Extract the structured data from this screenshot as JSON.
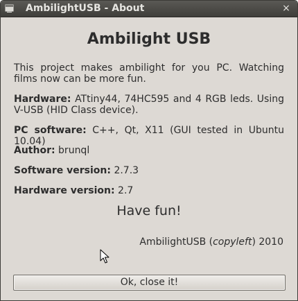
{
  "window": {
    "title": "AmbilightUSB - About",
    "close_glyph": "×"
  },
  "about": {
    "heading": "Ambilight USB",
    "description": "This project makes ambilight for you PC. Watching films now can be more fun.",
    "hardware_label": "Hardware:",
    "hardware_value": "ATtiny44, 74HC595 and 4 RGB leds. Using V-USB (HID Class device).",
    "pc_software_label": "PC software:",
    "pc_software_value": "C++, Qt, X11 (GUI tested in Ubuntu 10.04)",
    "author_label": "Author:",
    "author_value": "brunql",
    "software_version_label": "Software version:",
    "software_version_value": "2.7.3",
    "hardware_version_label": "Hardware version:",
    "hardware_version_value": "2.7",
    "have_fun": "Have fun!",
    "copy_name": "AmbilightUSB (",
    "copy_word": "copyleft",
    "copy_year": ") 2010"
  },
  "buttons": {
    "ok_label": "Ok, close it!"
  },
  "icons": {
    "app": "app-window-icon",
    "close": "close-icon",
    "cursor": "mouse-pointer-icon"
  }
}
